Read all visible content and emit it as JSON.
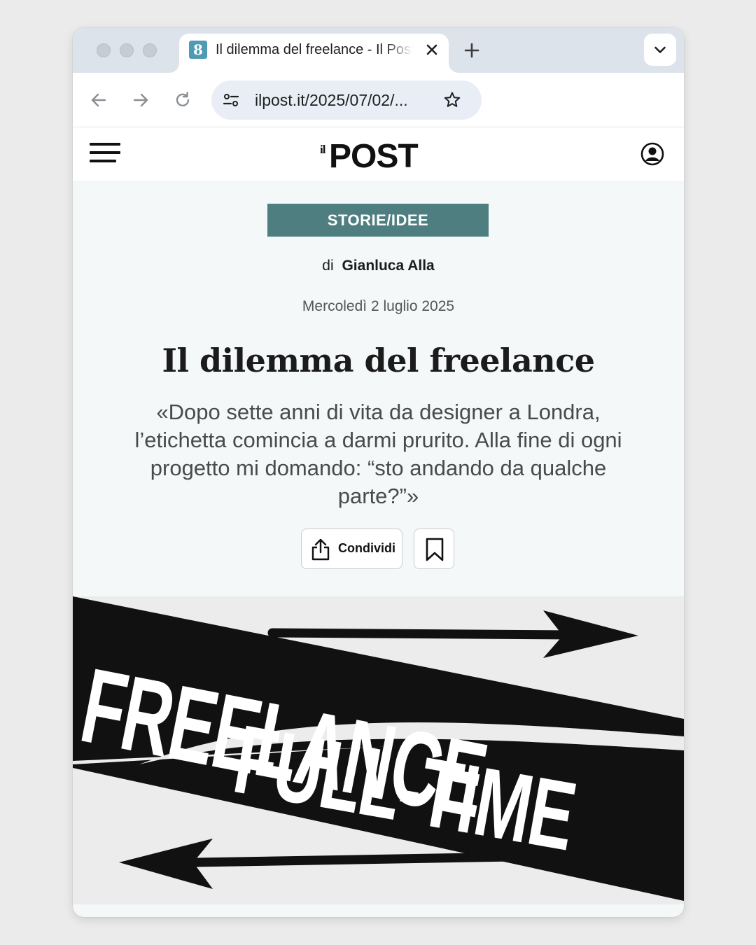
{
  "browser": {
    "tab_title": "Il dilemma del freelance - Il Post",
    "favicon_glyph": "8",
    "url": "ilpost.it/2025/07/02/..."
  },
  "site": {
    "logo_prefix": "il",
    "logo_word": "POST"
  },
  "article": {
    "category": "STORIE/IDEE",
    "byline_prefix": "di",
    "author": "Gianluca Alla",
    "date": "Mercoledì 2 luglio 2025",
    "title": "Il dilemma del freelance",
    "summary": "«Dopo sette anni di vita da designer a Londra, l’etichetta comincia a darmi prurito. Alla fine di ogni progetto mi domando: “sto andando da qualche parte?”»",
    "share_label": "Condividi"
  },
  "hero": {
    "text_top": "FREELANCE",
    "text_bottom": "FULL-TIME"
  },
  "colors": {
    "category_bg": "#4e7e7f",
    "favicon_bg": "#4f9bb4",
    "page_bg": "#f4f8f9"
  }
}
